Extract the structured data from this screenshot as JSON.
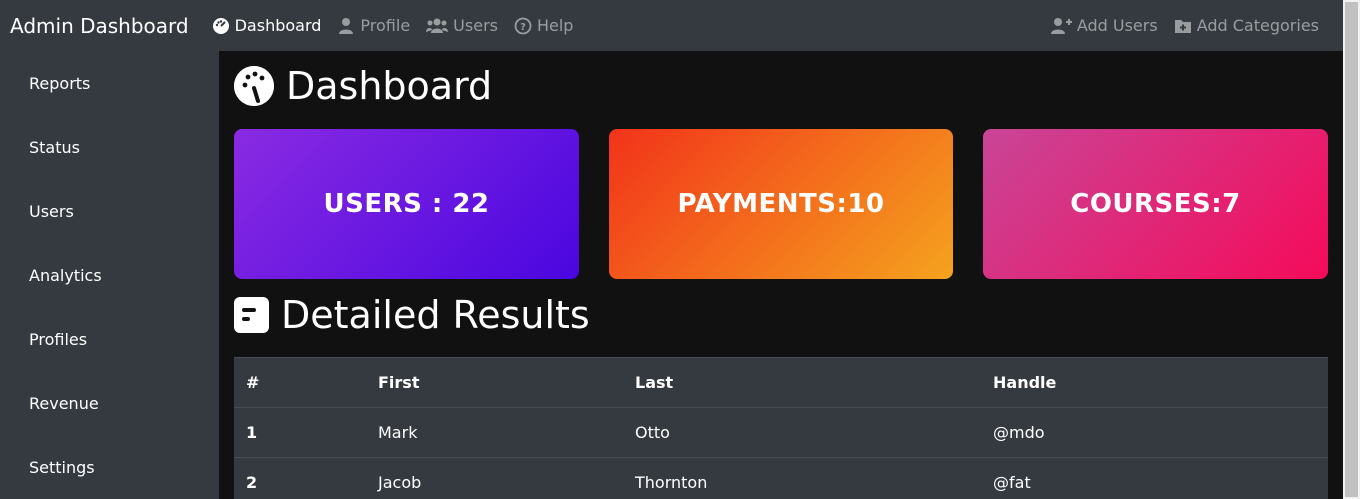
{
  "navbar": {
    "brand": "Admin Dashboard",
    "links": [
      {
        "label": "Dashboard",
        "icon": "tachometer-icon",
        "active": true
      },
      {
        "label": "Profile",
        "icon": "user-icon",
        "active": false
      },
      {
        "label": "Users",
        "icon": "users-icon",
        "active": false
      },
      {
        "label": "Help",
        "icon": "question-circle-icon",
        "active": false
      }
    ],
    "right_links": [
      {
        "label": "Add Users",
        "icon": "user-plus-icon"
      },
      {
        "label": "Add Categories",
        "icon": "folder-plus-icon"
      }
    ]
  },
  "sidebar": {
    "items": [
      {
        "label": "Reports"
      },
      {
        "label": "Status"
      },
      {
        "label": "Users"
      },
      {
        "label": "Analytics"
      },
      {
        "label": "Profiles"
      },
      {
        "label": "Revenue"
      },
      {
        "label": "Settings"
      }
    ]
  },
  "main": {
    "title": "Dashboard",
    "cards": [
      {
        "label": "USERS : 22"
      },
      {
        "label": "PAYMENTS:10"
      },
      {
        "label": "COURSES:7"
      }
    ],
    "section_title": "Detailed Results",
    "table": {
      "headers": [
        "#",
        "First",
        "Last",
        "Handle"
      ],
      "rows": [
        [
          "1",
          "Mark",
          "Otto",
          "@mdo"
        ],
        [
          "2",
          "Jacob",
          "Thornton",
          "@fat"
        ]
      ]
    }
  },
  "colors": {
    "navbar_bg": "#343a40",
    "body_bg": "#111111",
    "users_card": "#6a1be1",
    "payments_card": "#f36a1c",
    "courses_card": "#e2297a"
  }
}
